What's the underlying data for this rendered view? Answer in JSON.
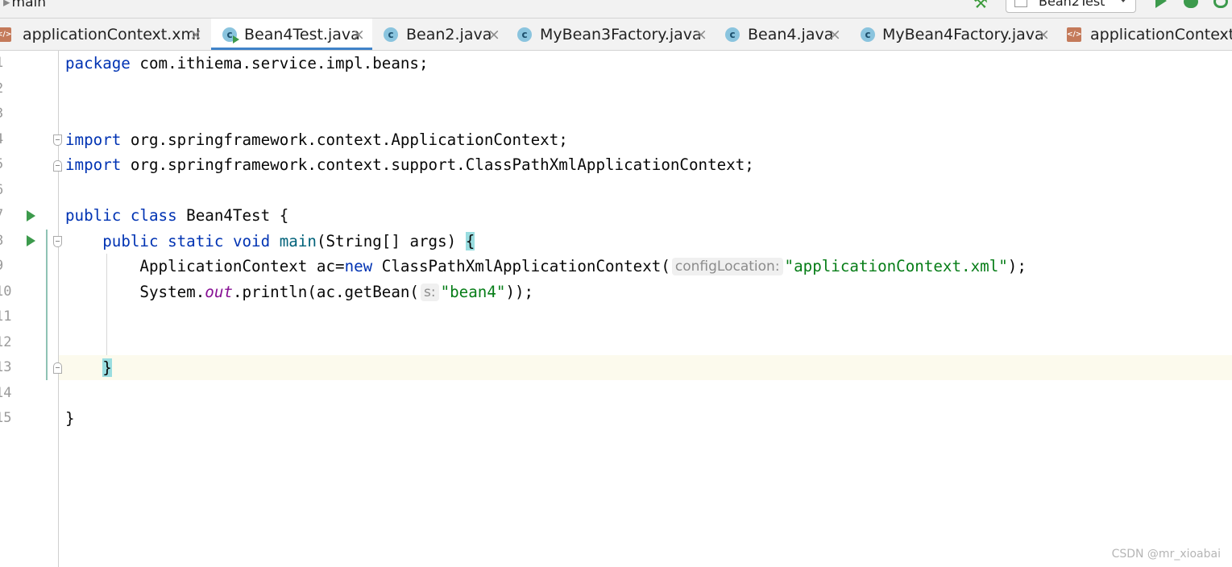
{
  "toolbar": {
    "breadcrumb": "main",
    "run_config": "Bean2Test"
  },
  "tabs": [
    {
      "label": "applicationContext.xml",
      "type": "xml",
      "active": false
    },
    {
      "label": "Bean4Test.java",
      "type": "java-run",
      "active": true
    },
    {
      "label": "Bean2.java",
      "type": "java",
      "active": false
    },
    {
      "label": "MyBean3Factory.java",
      "type": "java",
      "active": false
    },
    {
      "label": "Bean4.java",
      "type": "java",
      "active": false
    },
    {
      "label": "MyBean4Factory.java",
      "type": "java",
      "active": false
    },
    {
      "label": "applicationContext-U",
      "type": "xml",
      "active": false
    }
  ],
  "close_glyph": "×",
  "editor": {
    "line_numbers": [
      "1",
      "2",
      "3",
      "4",
      "5",
      "6",
      "7",
      "8",
      "9",
      "10",
      "11",
      "12",
      "13",
      "14",
      "15"
    ],
    "code": {
      "l1_kw": "package",
      "l1_rest": " com.ithiema.service.impl.beans;",
      "l4_kw": "import",
      "l4_rest": " org.springframework.context.ApplicationContext;",
      "l5_kw": "import",
      "l5_rest": " org.springframework.context.support.ClassPathXmlApplicationContext;",
      "l7_kw": "public class",
      "l7_rest": " Bean4Test {",
      "l8_indent": "    ",
      "l8_kw": "public static void",
      "l8_meth": "main",
      "l8_rest": "(String[] args) ",
      "l8_brace": "{",
      "l9_a": "        ApplicationContext ac=",
      "l9_kw": "new",
      "l9_b": " ClassPathXmlApplicationContext(",
      "l9_hint": "configLocation:",
      "l9_str": "\"applicationContext.xml\"",
      "l9_end": ");",
      "l10_a": "        System.",
      "l10_fld": "out",
      "l10_b": ".println(ac.getBean(",
      "l10_hint": "s:",
      "l10_str": "\"bean4\"",
      "l10_end": "));",
      "l13_indent": "    ",
      "l13_brace": "}",
      "l15": "}"
    }
  },
  "watermark": "CSDN @mr_xioabai"
}
